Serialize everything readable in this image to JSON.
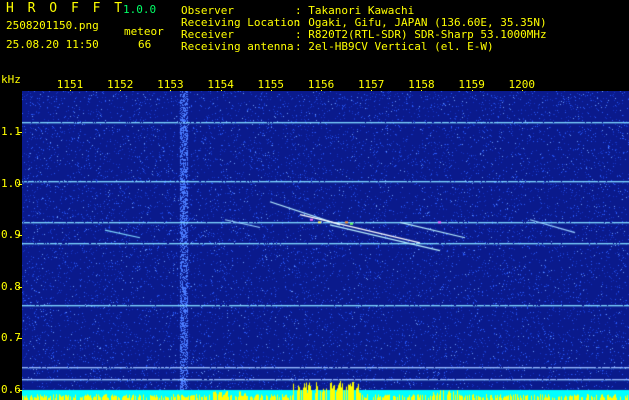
{
  "app": {
    "name": "H R O F F T",
    "version": "1.0.0",
    "filename": "2508201150.png",
    "datetime": "25.08.20 11:50",
    "meteor_label": "meteor",
    "meteor_count": "66"
  },
  "info": {
    "rows": [
      {
        "label": "Observer",
        "value": ": Takanori Kawachi"
      },
      {
        "label": "Receiving Location",
        "value": ": Ogaki, Gifu, JAPAN (136.60E, 35.35N)"
      },
      {
        "label": "Receiver",
        "value": ": R820T2(RTL-SDR) SDR-Sharp 53.1000MHz"
      },
      {
        "label": "Receiving antenna",
        "value": ": 2el-HB9CV Vertical (el. E-W)"
      }
    ]
  },
  "axes": {
    "y_unit": "kHz",
    "x_ticks": [
      "1151",
      "1152",
      "1153",
      "1154",
      "1155",
      "1156",
      "1157",
      "1158",
      "1159",
      "1200"
    ],
    "y_ticks": [
      "1.1",
      "1.0",
      "0.9",
      "0.8",
      "0.7",
      "0.6"
    ]
  },
  "chart_data": {
    "type": "heatmap",
    "x_ticks": [
      "1151",
      "1152",
      "1153",
      "1154",
      "1155",
      "1156",
      "1157",
      "1158",
      "1159",
      "1200"
    ],
    "y_ticks": [
      1.1,
      1.0,
      0.9,
      0.8,
      0.7,
      0.6
    ],
    "ylabel": "kHz",
    "ylim": [
      0.58,
      1.18
    ],
    "carriers_khz": [
      1.12,
      1.005,
      0.925,
      0.885,
      0.765,
      0.645,
      0.62
    ],
    "colors": {
      "background": "#0a1a8c",
      "noise": "#2a5cff",
      "carrier": "#7fd8ff",
      "meteor": "#ffffff",
      "bottom_band": "#00ffff",
      "bottom_peaks": "#ffff00"
    }
  }
}
